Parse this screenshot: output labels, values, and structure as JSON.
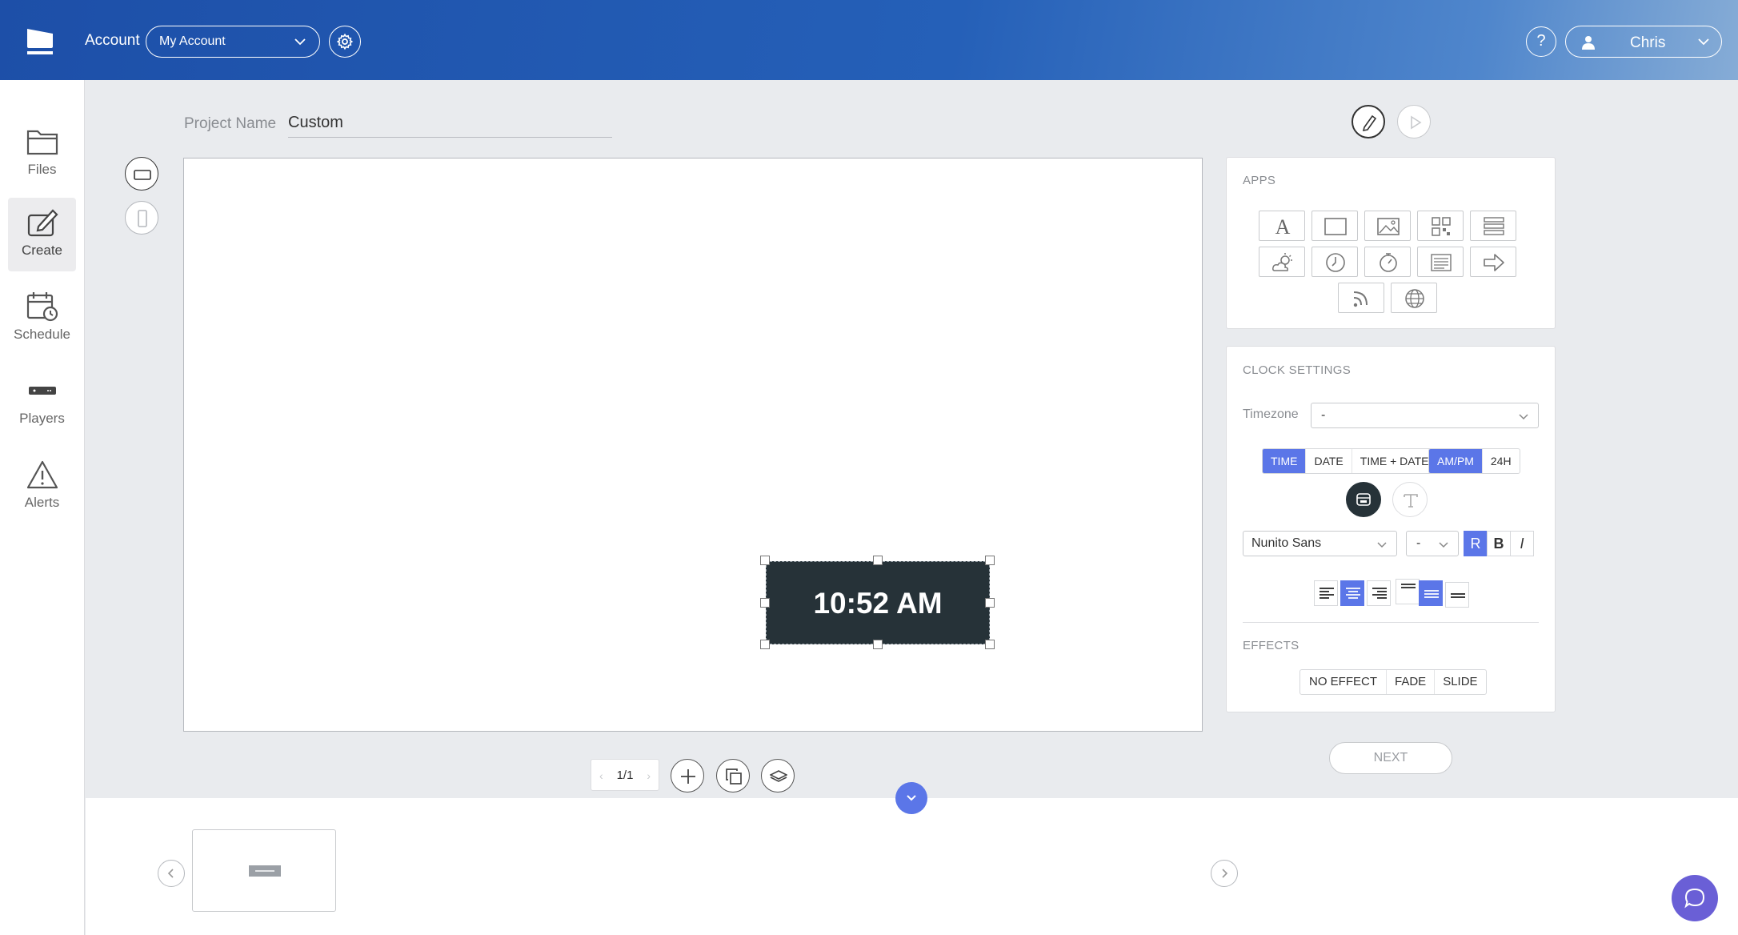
{
  "header": {
    "account_label": "Account",
    "account_select": "My Account",
    "help": "?",
    "user_name": "Chris"
  },
  "sidebar": {
    "items": [
      {
        "label": "Files",
        "icon": "folder-icon"
      },
      {
        "label": "Create",
        "icon": "edit-icon",
        "active": true
      },
      {
        "label": "Schedule",
        "icon": "calendar-clock-icon"
      },
      {
        "label": "Players",
        "icon": "player-device-icon"
      },
      {
        "label": "Alerts",
        "icon": "warning-icon"
      }
    ]
  },
  "project": {
    "label": "Project Name",
    "name": "Custom"
  },
  "canvas": {
    "clock_text": "10:52 AM",
    "clock_bg": "#263238"
  },
  "apps_panel": {
    "title": "APPS",
    "apps": [
      "text-icon",
      "shape-icon",
      "image-icon",
      "qr-code-icon",
      "table-icon",
      "weather-icon",
      "clock-icon",
      "timer-icon",
      "list-icon",
      "arrow-icon",
      "rss-icon",
      "web-icon"
    ]
  },
  "clock_settings": {
    "title": "CLOCK SETTINGS",
    "timezone_label": "Timezone",
    "timezone_value": "-",
    "mode_options": [
      "TIME",
      "DATE",
      "TIME + DATE"
    ],
    "mode_selected": "TIME",
    "format_options": [
      "AM/PM",
      "24H"
    ],
    "format_selected": "AM/PM",
    "font": "Nunito Sans",
    "font_size": "-",
    "style_buttons": [
      "R",
      "B",
      "I"
    ],
    "style_selected": "R",
    "accent": "#5b76e8"
  },
  "effects": {
    "title": "EFFECTS",
    "options": [
      "NO EFFECT",
      "FADE",
      "SLIDE"
    ]
  },
  "next_label": "NEXT",
  "pager": {
    "text": "1/1",
    "prev": "‹",
    "next": "›"
  }
}
